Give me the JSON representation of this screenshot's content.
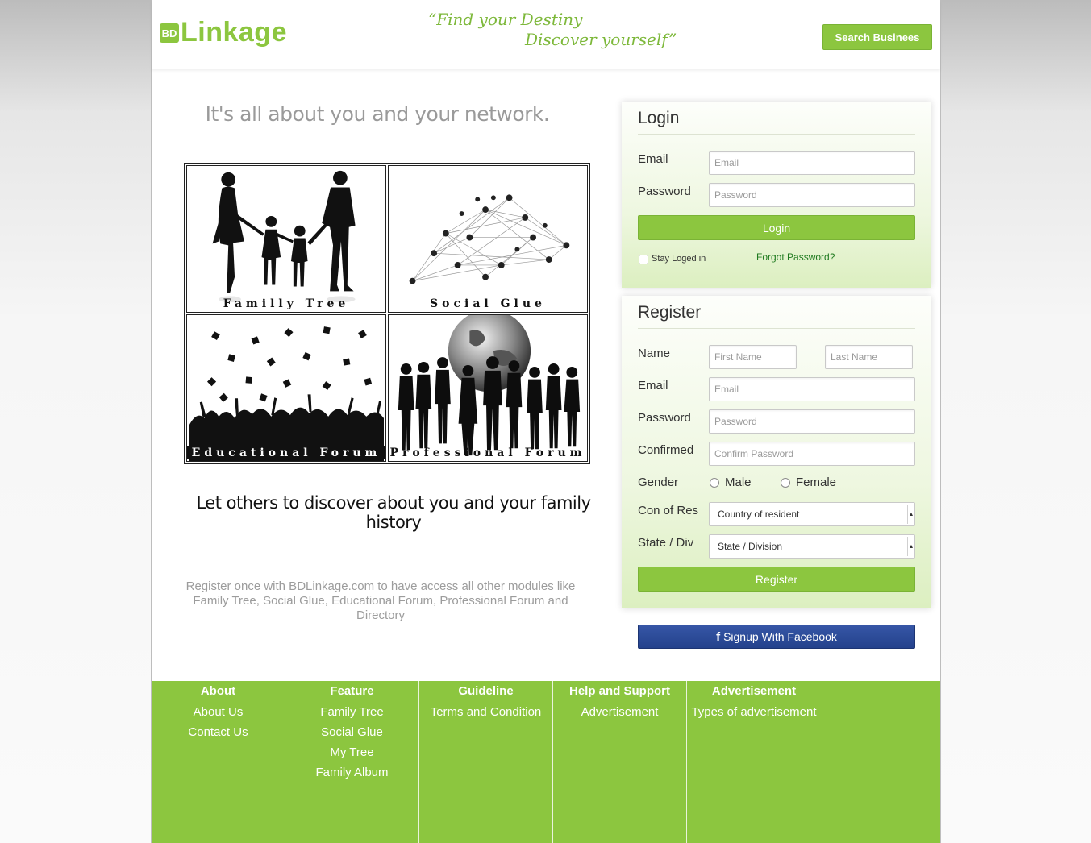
{
  "header": {
    "logo_badge": "BD",
    "logo_text": "Linkage",
    "tagline_line1": "“Find your Destiny",
    "tagline_line2": "Discover yourself”",
    "search_button": "Search Businees"
  },
  "main": {
    "headline": "It's all about you and your network.",
    "tiles": [
      {
        "label": "Familly Tree"
      },
      {
        "label": "Social Glue"
      },
      {
        "label": "Educational Forum"
      },
      {
        "label": "Professional Forum"
      }
    ],
    "subline": "Let others to discover about you and your family history",
    "description": "Register once with BDLinkage.com to have access all other modules like Family Tree, Social Glue, Educational Forum, Professional Forum and Directory"
  },
  "login": {
    "title": "Login",
    "email_label": "Email",
    "email_placeholder": "Email",
    "password_label": "Password",
    "password_placeholder": "Password",
    "button": "Login",
    "stay_logged": "Stay Loged in",
    "forgot": "Forgot Password?"
  },
  "register": {
    "title": "Register",
    "name_label": "Name",
    "first_placeholder": "First Name",
    "last_placeholder": "Last Name",
    "email_label": "Email",
    "email_placeholder": "Email",
    "password_label": "Password",
    "password_placeholder": "Password",
    "confirm_label": "Confirmed",
    "confirm_placeholder": "Confirm Password",
    "gender_label": "Gender",
    "male": "Male",
    "female": "Female",
    "country_label": "Con of Res",
    "country_value": "Country of resident",
    "state_label": "State / Div",
    "state_value": "State / Division",
    "button": "Register",
    "facebook_icon": "f",
    "facebook": "Signup With Facebook"
  },
  "footer": {
    "columns": [
      {
        "title": "About",
        "links": [
          "About Us",
          "Contact Us"
        ]
      },
      {
        "title": "Feature",
        "links": [
          "Family Tree",
          "Social Glue",
          "My Tree",
          "Family Album"
        ]
      },
      {
        "title": "Guideline",
        "links": [
          "Terms and Condition"
        ]
      },
      {
        "title": "Help and Support",
        "links": [
          "Advertisement"
        ]
      },
      {
        "title": "Advertisement",
        "links": [
          "Types of advertisement"
        ]
      }
    ]
  },
  "colors": {
    "brand_green": "#8cc63f",
    "facebook_blue": "#2b4a98",
    "forgot_link": "#1f7a1f"
  }
}
